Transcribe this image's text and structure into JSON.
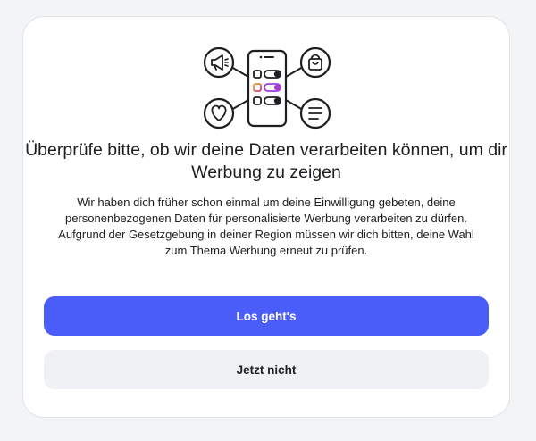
{
  "dialog": {
    "title": "Überprüfe bitte, ob wir deine Daten verarbeiten können, um dir Werbung zu zeigen",
    "body": "Wir haben dich früher schon einmal um deine Einwilligung gebeten, deine personenbezogenen Daten für personalisierte Werbung verarbeiten zu dürfen. Aufgrund der Gesetzgebung in deiner Region müssen wir dich bitten, deine Wahl zum Thema Werbung erneut zu prüfen.",
    "primary_button": "Los geht's",
    "secondary_button": "Jetzt nicht"
  },
  "illustration": {
    "icons": [
      "megaphone-icon",
      "shopping-bag-icon",
      "heart-icon",
      "menu-lines-icon",
      "phone-icon"
    ],
    "colors": {
      "stroke": "#1c1e21",
      "accent_gradient_start": "#f5a623",
      "accent_gradient_end": "#c13584",
      "toggle_purple": "#a33bd9"
    }
  },
  "colors": {
    "primary": "#4a5df9",
    "secondary_bg": "#f0f1f4",
    "text": "#1c1e21"
  }
}
